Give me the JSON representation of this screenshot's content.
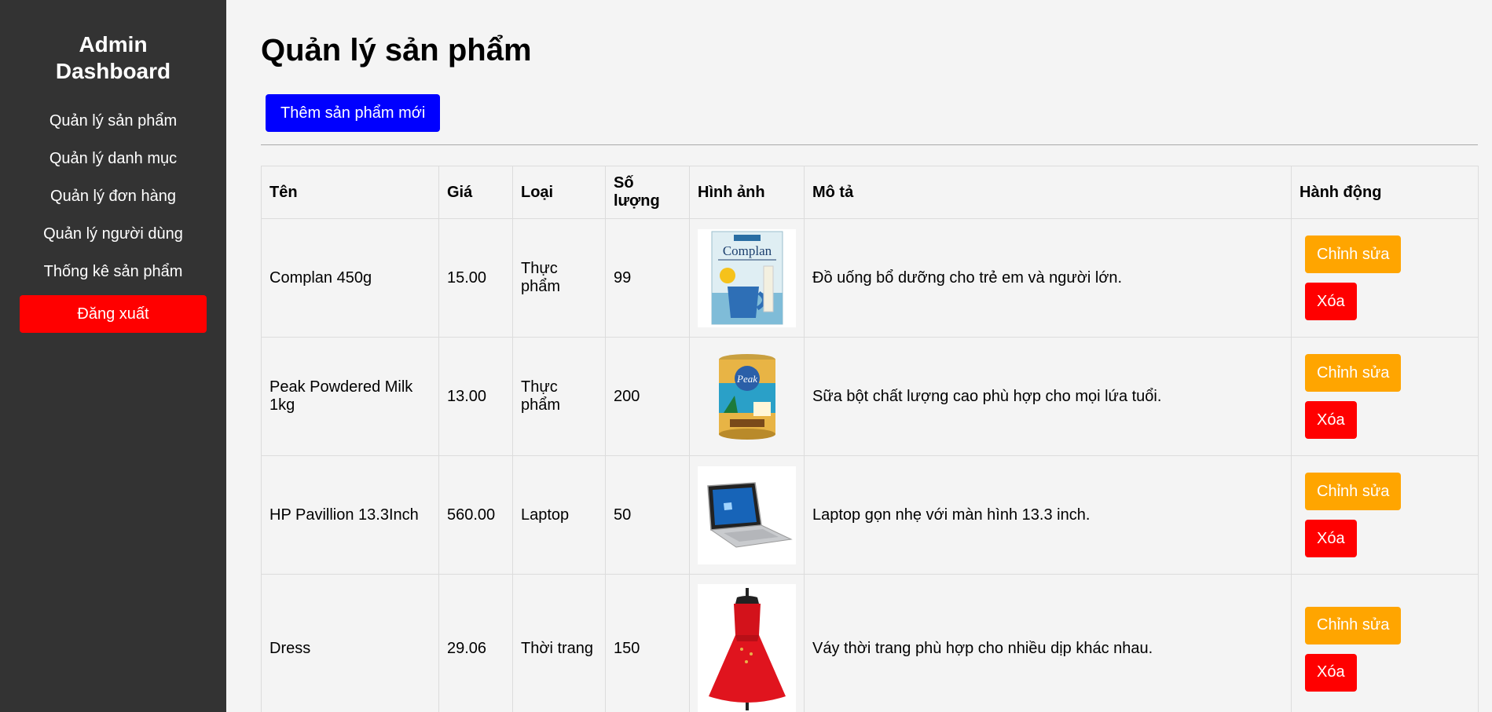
{
  "sidebar": {
    "title_line1": "Admin",
    "title_line2": "Dashboard",
    "items": [
      {
        "label": "Quản lý sản phẩm"
      },
      {
        "label": "Quản lý danh mục"
      },
      {
        "label": "Quản lý đơn hàng"
      },
      {
        "label": "Quản lý người dùng"
      },
      {
        "label": "Thống kê sản phẩm"
      }
    ],
    "logout_label": "Đăng xuất"
  },
  "main": {
    "title": "Quản lý sản phẩm",
    "add_button_label": "Thêm sản phẩm mới"
  },
  "table": {
    "headers": [
      "Tên",
      "Giá",
      "Loại",
      "Số lượng",
      "Hình ảnh",
      "Mô tả",
      "Hành động"
    ],
    "edit_label": "Chỉnh sửa",
    "delete_label": "Xóa",
    "rows": [
      {
        "name": "Complan 450g",
        "price": "15.00",
        "type": "Thực phẩm",
        "qty": "99",
        "image_icon": "complan-box-image",
        "image_text": "Complan",
        "description": "Đồ uống bổ dưỡng cho trẻ em và người lớn."
      },
      {
        "name": "Peak Powdered Milk 1kg",
        "price": "13.00",
        "type": "Thực phẩm",
        "qty": "200",
        "image_icon": "peak-milk-can-image",
        "image_text": "Peak",
        "description": "Sữa bột chất lượng cao phù hợp cho mọi lứa tuổi."
      },
      {
        "name": "HP Pavillion 13.3Inch",
        "price": "560.00",
        "type": "Laptop",
        "qty": "50",
        "image_icon": "laptop-image",
        "description": "Laptop gọn nhẹ với màn hình 13.3 inch."
      },
      {
        "name": "Dress",
        "price": "29.06",
        "type": "Thời trang",
        "qty": "150",
        "image_icon": "red-dress-image",
        "description": "Váy thời trang phù hợp cho nhiều dịp khác nhau."
      }
    ]
  },
  "colors": {
    "sidebar_bg": "#333333",
    "logout": "#ff0000",
    "add_button": "#0000ff",
    "edit_button": "#ffa500",
    "delete_button": "#ff0000"
  }
}
